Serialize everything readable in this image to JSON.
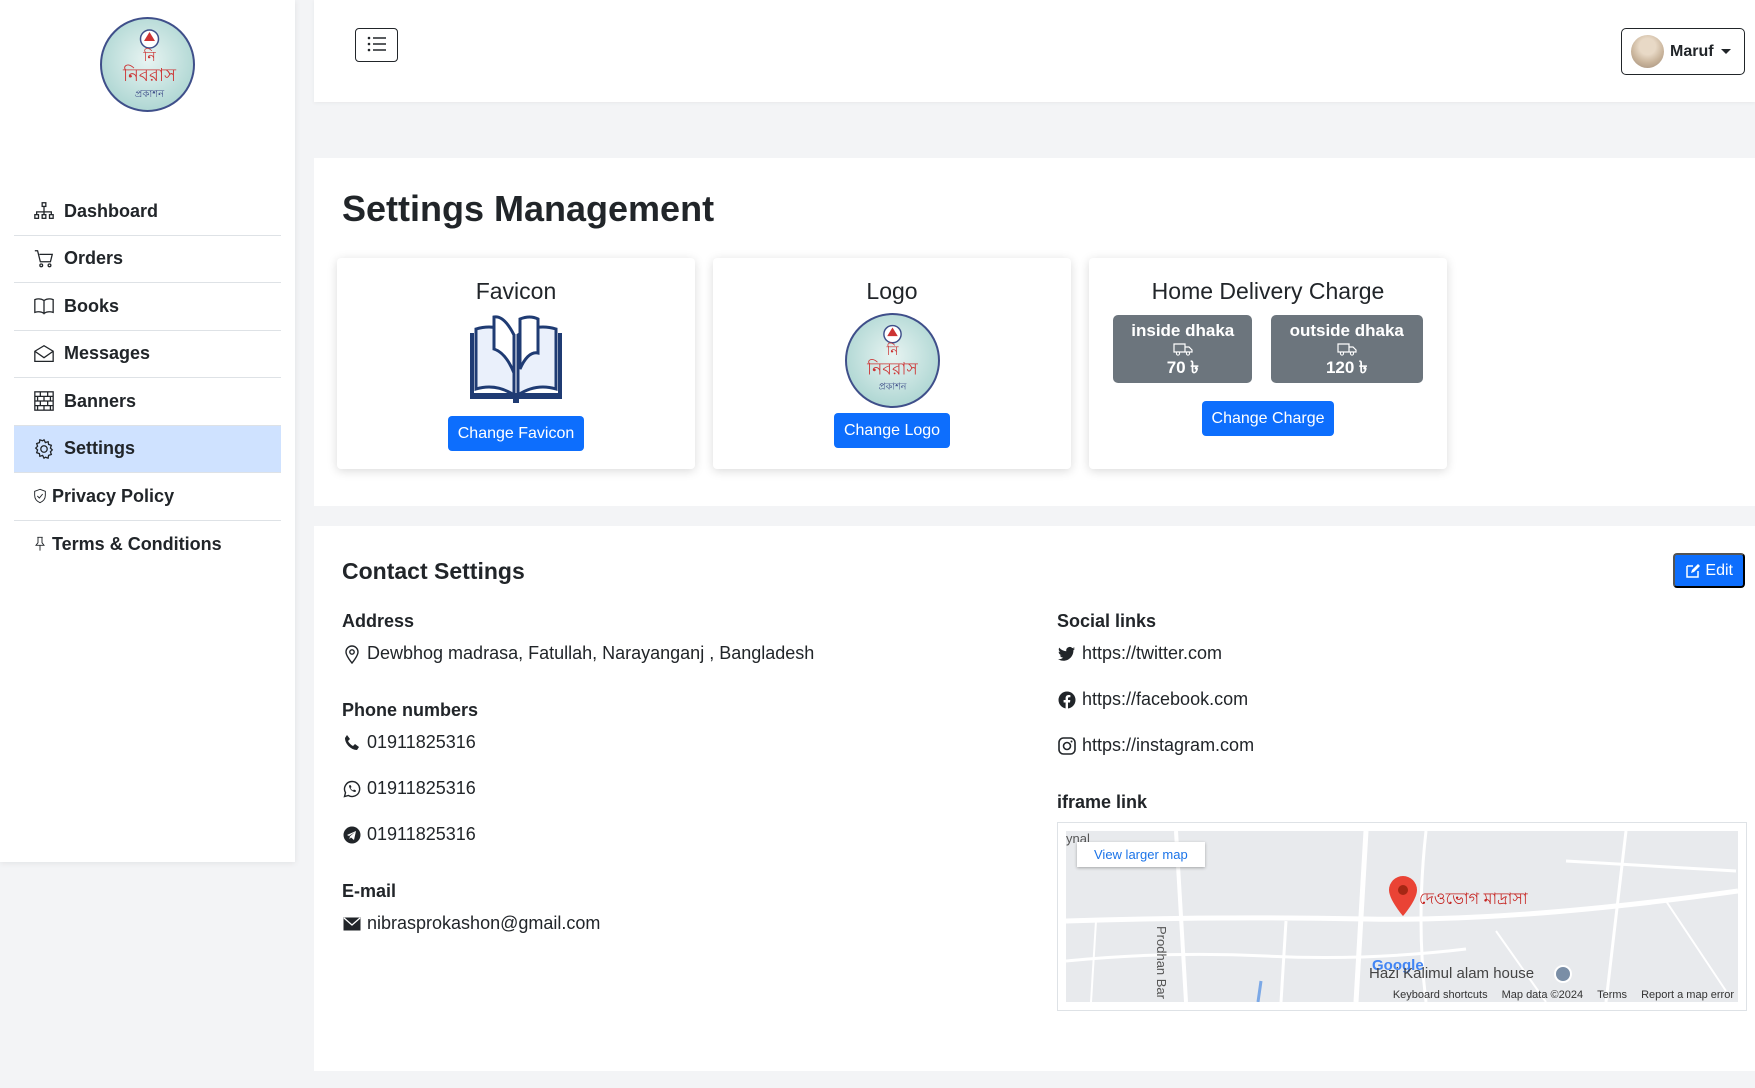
{
  "sidebar": {
    "items": [
      {
        "label": "Dashboard",
        "icon": "sitemap-icon"
      },
      {
        "label": "Orders",
        "icon": "cart-icon"
      },
      {
        "label": "Books",
        "icon": "book-icon"
      },
      {
        "label": "Messages",
        "icon": "envelope-icon"
      },
      {
        "label": "Banners",
        "icon": "bricks-icon"
      },
      {
        "label": "Settings",
        "icon": "gear-icon",
        "active": true
      },
      {
        "label": "Privacy Policy",
        "icon": "shield-check-icon"
      },
      {
        "label": "Terms & Conditions",
        "icon": "pin-icon"
      }
    ]
  },
  "header": {
    "user_name": "Maruf"
  },
  "settings": {
    "title": "Settings Management",
    "favicon": {
      "title": "Favicon",
      "button": "Change Favicon"
    },
    "logo": {
      "title": "Logo",
      "button": "Change Logo"
    },
    "delivery": {
      "title": "Home Delivery Charge",
      "inside_label": "inside dhaka",
      "inside_value": "70 ৳",
      "outside_label": "outside dhaka",
      "outside_value": "120 ৳",
      "button": "Change Charge"
    }
  },
  "contact": {
    "title": "Contact Settings",
    "edit_label": "Edit",
    "address_label": "Address",
    "address": "Dewbhog madrasa, Fatullah, Narayanganj , Bangladesh",
    "phone_label": "Phone numbers",
    "phone": "01911825316",
    "whatsapp": "01911825316",
    "telegram": "01911825316",
    "email_label": "E-mail",
    "email": "nibrasprokashon@gmail.com",
    "social_label": "Social links",
    "twitter": "https://twitter.com",
    "facebook": "https://facebook.com",
    "instagram": "https://instagram.com",
    "iframe_label": "iframe link",
    "map": {
      "view_larger": "View larger map",
      "place": "দেওভোগ মাদ্রাসা",
      "street": "Prodhan Bar",
      "corner_text": "ynal",
      "hazi": "Hazi Kalimul alam house",
      "google": "Google",
      "shortcuts": "Keyboard shortcuts",
      "mapdata": "Map data ©2024",
      "terms": "Terms",
      "report": "Report a map error"
    }
  },
  "colors": {
    "primary": "#0d6efd",
    "active_nav": "#cfe2ff",
    "secondary": "#6c757d"
  }
}
